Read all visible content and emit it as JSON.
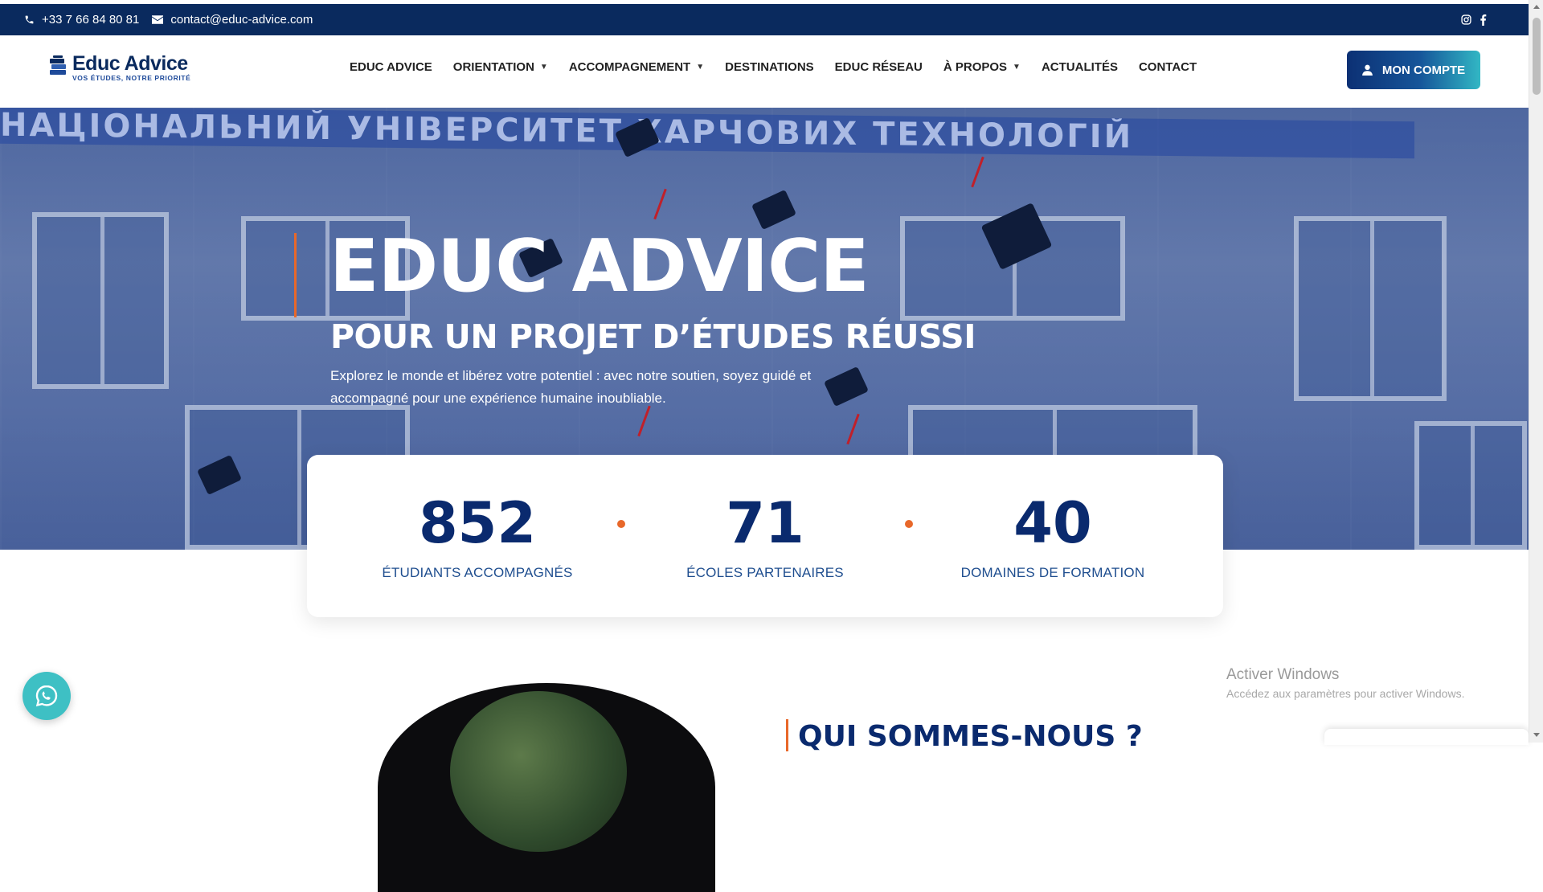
{
  "topbar": {
    "phone": "+33 7 66 84 80 81",
    "email": "contact@educ-advice.com",
    "social": [
      "instagram-icon",
      "facebook-icon"
    ]
  },
  "header": {
    "logo_name": "Educ Advice",
    "logo_tagline": "VOS ÉTUDES, NOTRE PRIORITÉ",
    "nav": [
      {
        "label": "EDUC ADVICE",
        "dropdown": false
      },
      {
        "label": "ORIENTATION",
        "dropdown": true
      },
      {
        "label": "ACCOMPAGNEMENT",
        "dropdown": true
      },
      {
        "label": "DESTINATIONS",
        "dropdown": false
      },
      {
        "label": "EDUC RÉSEAU",
        "dropdown": false
      },
      {
        "label": "À PROPOS",
        "dropdown": true
      },
      {
        "label": "ACTUALITÉS",
        "dropdown": false
      },
      {
        "label": "CONTACT",
        "dropdown": false
      }
    ],
    "account_button": "MON COMPTE"
  },
  "hero": {
    "background_sign": "НАЦІОНАЛЬНИЙ УНІВЕРСИТЕТ ХАРЧОВИХ ТЕХНОЛОГІЙ",
    "title": "EDUC ADVICE",
    "subtitle": "POUR UN PROJET D’ÉTUDES RÉUSSI",
    "description": "Explorez le monde et libérez votre potentiel : avec notre soutien, soyez guidé et accompagné pour une expérience humaine inoubliable."
  },
  "stats": [
    {
      "value": "852",
      "label": "ÉTUDIANTS ACCOMPAGNÉS"
    },
    {
      "value": "71",
      "label": "ÉCOLES PARTENAIRES"
    },
    {
      "value": "40",
      "label": "DOMAINES DE FORMATION"
    }
  ],
  "about": {
    "title": "QUI SOMMES-NOUS ?"
  },
  "windows_watermark": {
    "title": "Activer Windows",
    "subtitle": "Accédez aux paramètres pour activer Windows."
  },
  "colors": {
    "navy": "#0a2a5e",
    "accent_orange": "#e8682a",
    "stat_blue": "#0a2a6e",
    "whatsapp_teal": "#3ec0c4"
  }
}
